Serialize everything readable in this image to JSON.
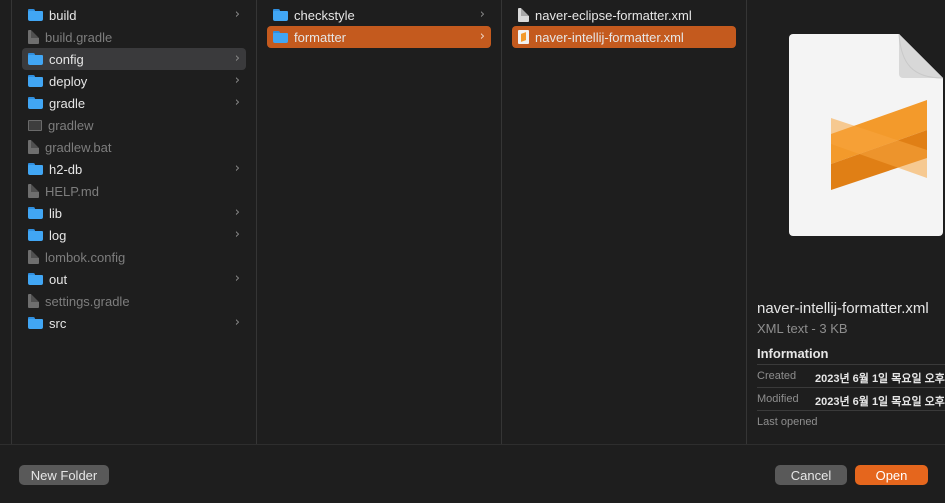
{
  "columns": {
    "col1": [
      {
        "name": "build",
        "type": "folder",
        "chevron": true,
        "selected": false,
        "dim": false
      },
      {
        "name": "build.gradle",
        "type": "doc",
        "chevron": false,
        "selected": false,
        "dim": true
      },
      {
        "name": "config",
        "type": "folder",
        "chevron": true,
        "selected": "gray",
        "dim": false
      },
      {
        "name": "deploy",
        "type": "folder",
        "chevron": true,
        "selected": false,
        "dim": false
      },
      {
        "name": "gradle",
        "type": "folder",
        "chevron": true,
        "selected": false,
        "dim": false
      },
      {
        "name": "gradlew",
        "type": "terminal",
        "chevron": false,
        "selected": false,
        "dim": true
      },
      {
        "name": "gradlew.bat",
        "type": "doc",
        "chevron": false,
        "selected": false,
        "dim": true
      },
      {
        "name": "h2-db",
        "type": "folder",
        "chevron": true,
        "selected": false,
        "dim": false
      },
      {
        "name": "HELP.md",
        "type": "doc",
        "chevron": false,
        "selected": false,
        "dim": true
      },
      {
        "name": "lib",
        "type": "folder",
        "chevron": true,
        "selected": false,
        "dim": false
      },
      {
        "name": "log",
        "type": "folder",
        "chevron": true,
        "selected": false,
        "dim": false
      },
      {
        "name": "lombok.config",
        "type": "doc",
        "chevron": false,
        "selected": false,
        "dim": true
      },
      {
        "name": "out",
        "type": "folder",
        "chevron": true,
        "selected": false,
        "dim": false
      },
      {
        "name": "settings.gradle",
        "type": "doc",
        "chevron": false,
        "selected": false,
        "dim": true
      },
      {
        "name": "src",
        "type": "folder",
        "chevron": true,
        "selected": false,
        "dim": false
      }
    ],
    "col2": [
      {
        "name": "checkstyle",
        "type": "folder",
        "chevron": true,
        "selected": false,
        "dim": false
      },
      {
        "name": "formatter",
        "type": "folder",
        "chevron": true,
        "selected": "orange",
        "dim": false
      }
    ],
    "col3": [
      {
        "name": "naver-eclipse-formatter.xml",
        "type": "doc",
        "chevron": false,
        "selected": false,
        "dim": false
      },
      {
        "name": "naver-intellij-formatter.xml",
        "type": "sublime",
        "chevron": false,
        "selected": "orange",
        "dim": false
      }
    ]
  },
  "chevron_glyph": "›",
  "preview": {
    "file_name": "naver-intellij-formatter.xml",
    "kind": "XML text - 3 KB",
    "info_heading": "Information",
    "rows": [
      {
        "key": "Created",
        "value": "2023년 6월 1일 목요일 오후"
      },
      {
        "key": "Modified",
        "value": "2023년 6월 1일 목요일 오후"
      },
      {
        "key": "Last opened",
        "value": ""
      }
    ],
    "icon": "sublime-text-document-icon",
    "accent": "#f39a2b"
  },
  "buttons": {
    "new_folder": "New Folder",
    "cancel": "Cancel",
    "open": "Open"
  },
  "colors": {
    "selection_orange": "#c45a1e",
    "selection_gray": "#3a3a3c",
    "open_button": "#e5661d",
    "folder": "#41a6f4"
  }
}
